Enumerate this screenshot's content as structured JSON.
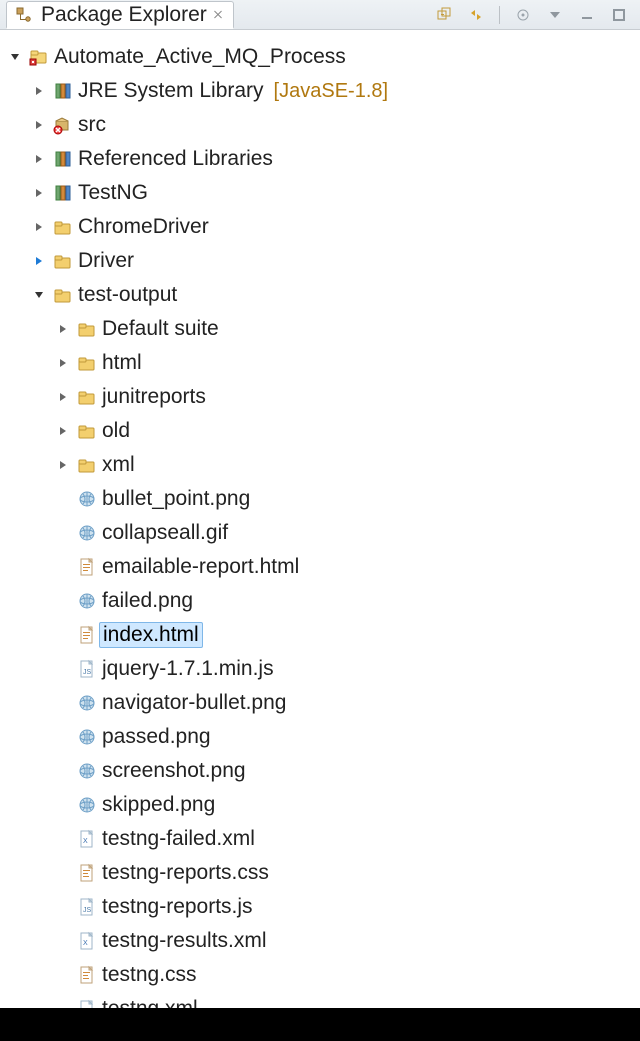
{
  "view": {
    "title": "Package Explorer"
  },
  "toolbar": {
    "collapse_all": "collapse-all-icon",
    "link_editor": "link-with-editor-icon",
    "menu": "view-menu-icon",
    "minimize": "minimize-icon",
    "maximize": "maximize-icon"
  },
  "tree": {
    "root": {
      "label": "Automate_Active_MQ_Process",
      "expanded": true,
      "children": [
        {
          "label": "JRE System Library",
          "suffix": "[JavaSE-1.8]",
          "icon": "library",
          "twisty": ">"
        },
        {
          "label": "src",
          "icon": "package-error",
          "twisty": ">"
        },
        {
          "label": "Referenced Libraries",
          "icon": "library",
          "twisty": ">"
        },
        {
          "label": "TestNG",
          "icon": "library",
          "twisty": ">"
        },
        {
          "label": "ChromeDriver",
          "icon": "folder",
          "twisty": ">"
        },
        {
          "label": "Driver",
          "icon": "folder",
          "twisty": ">",
          "twisty_blue": true
        },
        {
          "label": "test-output",
          "icon": "folder",
          "twisty": "v",
          "expanded": true,
          "children": [
            {
              "label": "Default suite",
              "icon": "folder",
              "twisty": ">"
            },
            {
              "label": "html",
              "icon": "folder",
              "twisty": ">"
            },
            {
              "label": "junitreports",
              "icon": "folder",
              "twisty": ">"
            },
            {
              "label": "old",
              "icon": "folder",
              "twisty": ">"
            },
            {
              "label": "xml",
              "icon": "folder",
              "twisty": ">"
            },
            {
              "label": "bullet_point.png",
              "icon": "globe",
              "twisty": ""
            },
            {
              "label": "collapseall.gif",
              "icon": "globe",
              "twisty": ""
            },
            {
              "label": "emailable-report.html",
              "icon": "htmlfile",
              "twisty": ""
            },
            {
              "label": "failed.png",
              "icon": "globe",
              "twisty": ""
            },
            {
              "label": "index.html",
              "icon": "htmlfile",
              "twisty": "",
              "selected": true
            },
            {
              "label": "jquery-1.7.1.min.js",
              "icon": "jsfile",
              "twisty": ""
            },
            {
              "label": "navigator-bullet.png",
              "icon": "globe",
              "twisty": ""
            },
            {
              "label": "passed.png",
              "icon": "globe",
              "twisty": ""
            },
            {
              "label": "screenshot.png",
              "icon": "globe",
              "twisty": ""
            },
            {
              "label": "skipped.png",
              "icon": "globe",
              "twisty": ""
            },
            {
              "label": "testng-failed.xml",
              "icon": "xmlfile",
              "twisty": ""
            },
            {
              "label": "testng-reports.css",
              "icon": "cssfile",
              "twisty": ""
            },
            {
              "label": "testng-reports.js",
              "icon": "jsfile",
              "twisty": ""
            },
            {
              "label": "testng-results.xml",
              "icon": "xmlfile",
              "twisty": ""
            },
            {
              "label": "testng.css",
              "icon": "cssfile",
              "twisty": ""
            }
          ]
        },
        {
          "label": "testng.xml",
          "icon": "xmlfile",
          "twisty": "",
          "depth_override": 2
        }
      ]
    }
  }
}
